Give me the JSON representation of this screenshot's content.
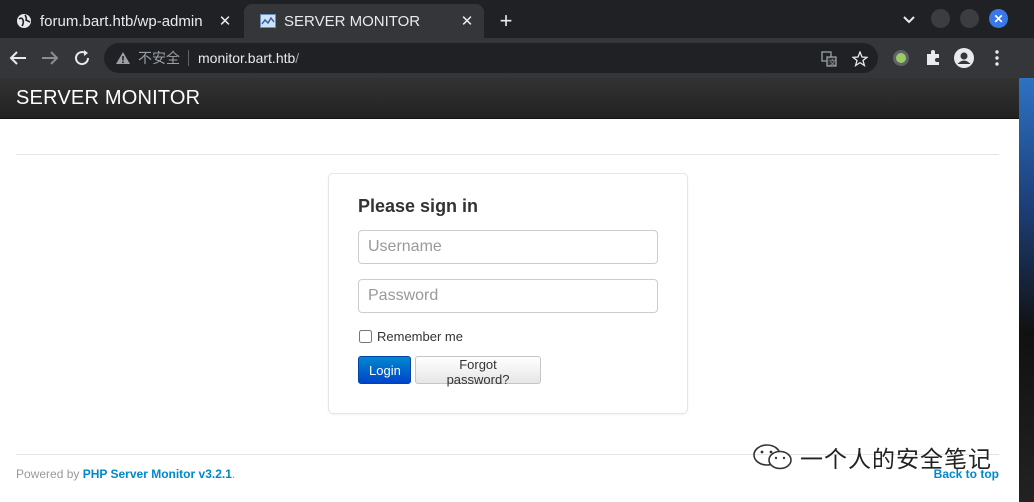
{
  "browser": {
    "tabs": [
      {
        "title": "forum.bart.htb/wp-admin",
        "icon": "globe-icon",
        "active": false
      },
      {
        "title": "SERVER MONITOR",
        "icon": "page-favicon",
        "active": true
      }
    ],
    "new_tab_label": "+",
    "address": {
      "security_label": "不安全",
      "host": "monitor.bart.htb",
      "path": "/"
    }
  },
  "page": {
    "brand": "SERVER MONITOR",
    "signin": {
      "heading": "Please sign in",
      "username_placeholder": "Username",
      "password_placeholder": "Password",
      "remember_label": "Remember me",
      "login_label": "Login",
      "forgot_label": "Forgot password?"
    },
    "footer": {
      "powered_prefix": "Powered by ",
      "powered_link": "PHP Server Monitor v3.2.1",
      "powered_suffix": ".",
      "back_to_top": "Back to top"
    },
    "watermark": "一个人的安全笔记"
  },
  "colors": {
    "accent": "#0088cc",
    "chrome_dark": "#202124",
    "navbar": "#222222"
  }
}
